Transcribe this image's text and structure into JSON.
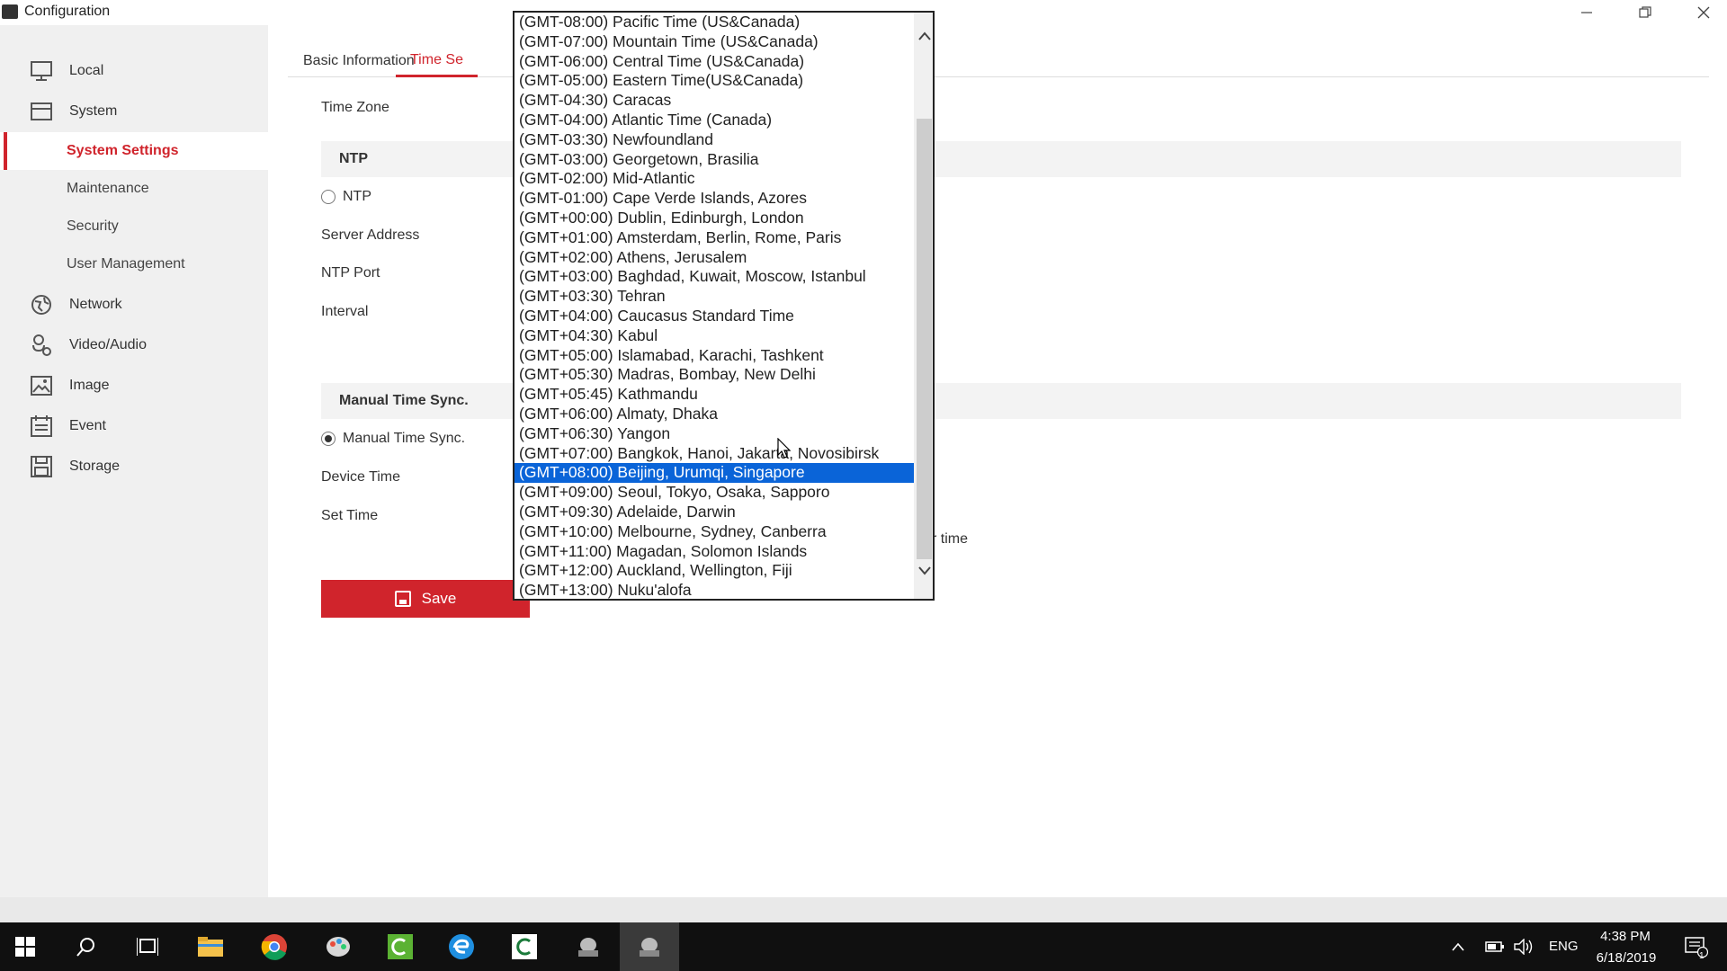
{
  "window": {
    "title": "Configuration"
  },
  "sidebar": {
    "items": [
      {
        "label": "Local",
        "icon": "monitor-icon"
      },
      {
        "label": "System",
        "icon": "window-icon"
      },
      {
        "label": "Network",
        "icon": "globe-icon"
      },
      {
        "label": "Video/Audio",
        "icon": "microphone-icon"
      },
      {
        "label": "Image",
        "icon": "image-icon"
      },
      {
        "label": "Event",
        "icon": "calendar-icon"
      },
      {
        "label": "Storage",
        "icon": "floppy-icon"
      }
    ],
    "system_sub": [
      {
        "label": "System Settings",
        "active": true
      },
      {
        "label": "Maintenance"
      },
      {
        "label": "Security"
      },
      {
        "label": "User Management"
      }
    ]
  },
  "tabs": [
    {
      "label": "Basic Information"
    },
    {
      "label": "Time Se",
      "active": true
    }
  ],
  "form": {
    "time_zone_label": "Time Zone",
    "ntp_section": "NTP",
    "ntp_radio": "NTP",
    "server_address_label": "Server Address",
    "ntp_port_label": "NTP Port",
    "interval_label": "Interval",
    "manual_section": "Manual Time Sync.",
    "manual_radio": "Manual Time Sync.",
    "device_time_label": "Device Time",
    "set_time_label": "Set Time",
    "partial_text": "r time",
    "save_label": "Save"
  },
  "timezone_dropdown": {
    "selected_index": 23,
    "options": [
      "(GMT-08:00) Pacific Time (US&Canada)",
      "(GMT-07:00) Mountain Time (US&Canada)",
      "(GMT-06:00) Central Time (US&Canada)",
      "(GMT-05:00) Eastern Time(US&Canada)",
      "(GMT-04:30) Caracas",
      "(GMT-04:00) Atlantic Time (Canada)",
      "(GMT-03:30) Newfoundland",
      "(GMT-03:00) Georgetown, Brasilia",
      "(GMT-02:00) Mid-Atlantic",
      "(GMT-01:00) Cape Verde Islands, Azores",
      "(GMT+00:00) Dublin, Edinburgh, London",
      "(GMT+01:00) Amsterdam, Berlin, Rome, Paris",
      "(GMT+02:00) Athens, Jerusalem",
      "(GMT+03:00) Baghdad, Kuwait, Moscow, Istanbul",
      "(GMT+03:30) Tehran",
      "(GMT+04:00) Caucasus Standard Time",
      "(GMT+04:30) Kabul",
      "(GMT+05:00) Islamabad, Karachi, Tashkent",
      "(GMT+05:30) Madras, Bombay, New Delhi",
      "(GMT+05:45) Kathmandu",
      "(GMT+06:00) Almaty, Dhaka",
      "(GMT+06:30) Yangon",
      "(GMT+07:00) Bangkok, Hanoi, Jakarta, Novosibirsk",
      "(GMT+08:00) Beijing, Urumqi, Singapore",
      "(GMT+09:00) Seoul, Tokyo, Osaka, Sapporo",
      "(GMT+09:30) Adelaide, Darwin",
      "(GMT+10:00) Melbourne, Sydney, Canberra",
      "(GMT+11:00) Magadan, Solomon Islands",
      "(GMT+12:00) Auckland, Wellington, Fiji",
      "(GMT+13:00) Nuku'alofa"
    ]
  },
  "taskbar": {
    "language": "ENG",
    "time": "4:38 PM",
    "date": "6/18/2019",
    "notification_count": "1"
  },
  "colors": {
    "accent": "#d0242c",
    "selection": "#0a64d8"
  }
}
